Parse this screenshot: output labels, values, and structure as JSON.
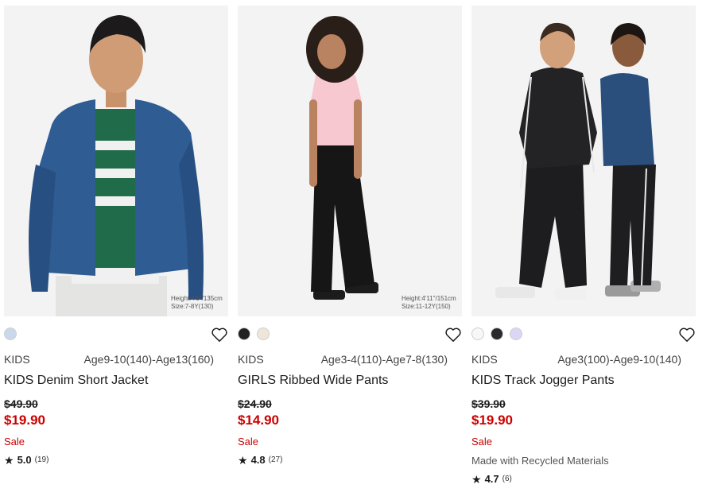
{
  "products": [
    {
      "size_note_1": "Height:4'5\"/135cm",
      "size_note_2": "Size:7-8Y(130)",
      "swatch_colors": [
        "#c9d9ea"
      ],
      "category": "KIDS",
      "sizes": "Age9-10(140)-Age13(160)",
      "name": "KIDS Denim Short Jacket",
      "old_price": "$49.90",
      "new_price": "$19.90",
      "sale_label": "Sale",
      "note": "",
      "rating_star": "★",
      "rating": "5.0",
      "review_count": "(19)"
    },
    {
      "size_note_1": "Height:4'11\"/151cm",
      "size_note_2": "Size:11-12Y(150)",
      "swatch_colors": [
        "#222222",
        "#efe6da"
      ],
      "category": "KIDS",
      "sizes": "Age3-4(110)-Age7-8(130)",
      "name": "GIRLS Ribbed Wide Pants",
      "old_price": "$24.90",
      "new_price": "$14.90",
      "sale_label": "Sale",
      "note": "",
      "rating_star": "★",
      "rating": "4.8",
      "review_count": "(27)"
    },
    {
      "size_note_1": "",
      "size_note_2": "",
      "swatch_colors": [
        "#f7f7f7",
        "#2a2a2e",
        "#ddd5f6"
      ],
      "category": "KIDS",
      "sizes": "Age3(100)-Age9-10(140)",
      "name": "KIDS Track Jogger Pants",
      "old_price": "$39.90",
      "new_price": "$19.90",
      "sale_label": "Sale",
      "note": "Made with Recycled Materials",
      "rating_star": "★",
      "rating": "4.7",
      "review_count": "(6)"
    }
  ],
  "icons": {
    "favorite": "heart-icon",
    "rating": "star-icon"
  },
  "colors": {
    "sale_red": "#cc0000",
    "text": "#1b1b1b",
    "photo_bg": "#f4f4f4"
  }
}
